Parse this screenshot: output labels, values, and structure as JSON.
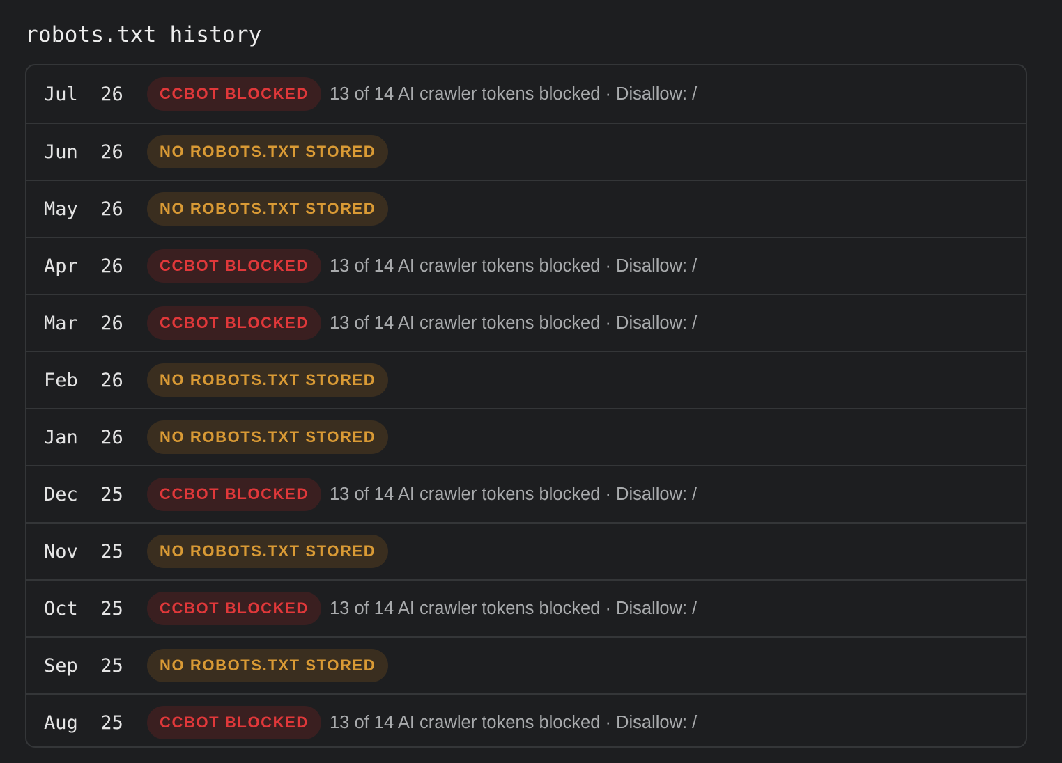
{
  "title": "robots.txt history",
  "colors": {
    "background": "#1d1e20",
    "border": "#343638",
    "blocked_text": "#e0383a",
    "blocked_bg": "#3a1f20",
    "none_text": "#d99a35",
    "none_bg": "#3a2e1f",
    "detail_text": "#a9abad"
  },
  "rows": [
    {
      "date": "Jul  26",
      "status": "blocked",
      "badge": "CCBOT BLOCKED",
      "detail": "13 of 14 AI crawler tokens blocked · Disallow: /"
    },
    {
      "date": "Jun  26",
      "status": "none",
      "badge": "NO ROBOTS.TXT STORED",
      "detail": ""
    },
    {
      "date": "May  26",
      "status": "none",
      "badge": "NO ROBOTS.TXT STORED",
      "detail": ""
    },
    {
      "date": "Apr  26",
      "status": "blocked",
      "badge": "CCBOT BLOCKED",
      "detail": "13 of 14 AI crawler tokens blocked · Disallow: /"
    },
    {
      "date": "Mar  26",
      "status": "blocked",
      "badge": "CCBOT BLOCKED",
      "detail": "13 of 14 AI crawler tokens blocked · Disallow: /"
    },
    {
      "date": "Feb  26",
      "status": "none",
      "badge": "NO ROBOTS.TXT STORED",
      "detail": ""
    },
    {
      "date": "Jan  26",
      "status": "none",
      "badge": "NO ROBOTS.TXT STORED",
      "detail": ""
    },
    {
      "date": "Dec  25",
      "status": "blocked",
      "badge": "CCBOT BLOCKED",
      "detail": "13 of 14 AI crawler tokens blocked · Disallow: /"
    },
    {
      "date": "Nov  25",
      "status": "none",
      "badge": "NO ROBOTS.TXT STORED",
      "detail": ""
    },
    {
      "date": "Oct  25",
      "status": "blocked",
      "badge": "CCBOT BLOCKED",
      "detail": "13 of 14 AI crawler tokens blocked · Disallow: /"
    },
    {
      "date": "Sep  25",
      "status": "none",
      "badge": "NO ROBOTS.TXT STORED",
      "detail": ""
    },
    {
      "date": "Aug  25",
      "status": "blocked",
      "badge": "CCBOT BLOCKED",
      "detail": "13 of 14 AI crawler tokens blocked · Disallow: /"
    }
  ]
}
